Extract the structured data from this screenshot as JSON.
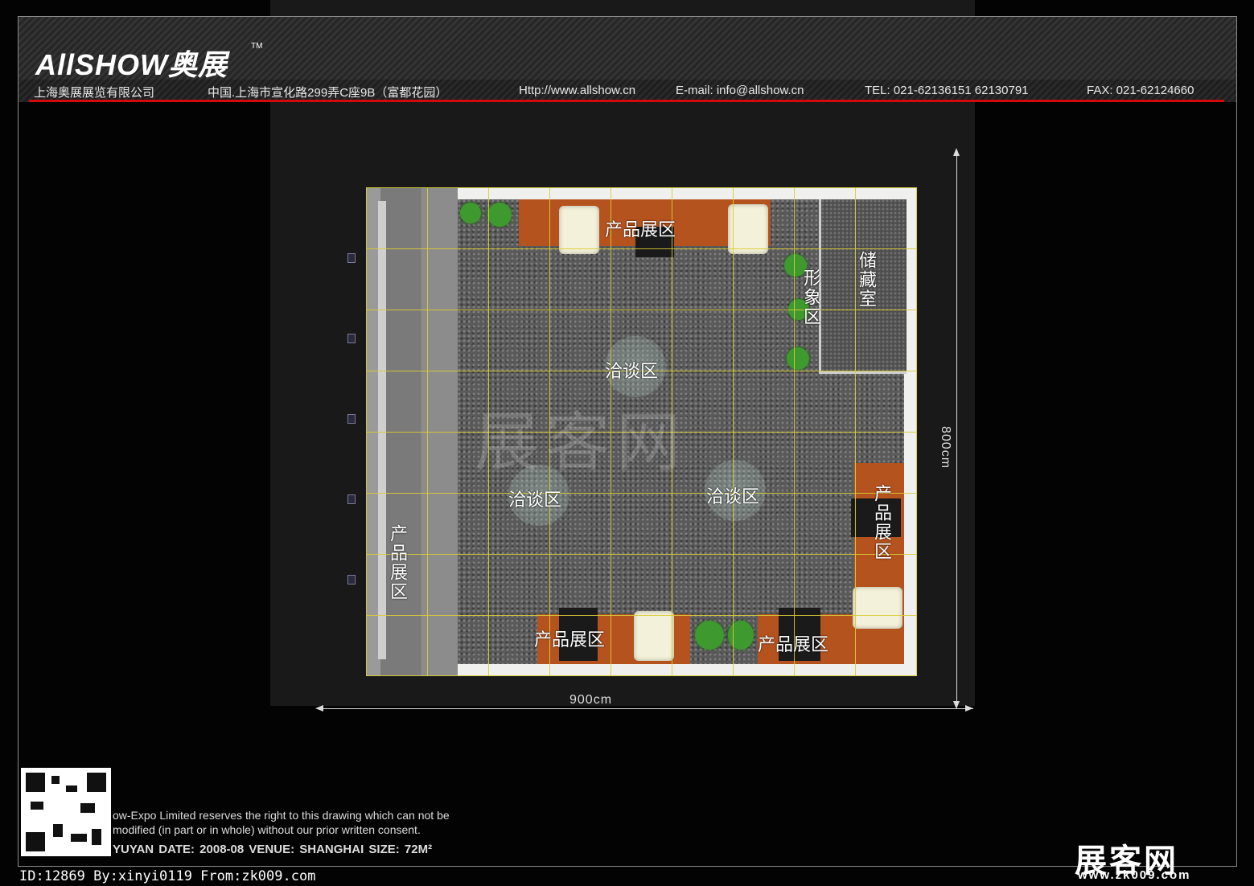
{
  "header": {
    "logo": "AllSHOW奥展",
    "logo_tm": "TM",
    "company": "上海奥展展览有限公司",
    "address": "中国.上海市宣化路299弄C座9B（富都花园）",
    "website": "Http://www.allshow.cn",
    "email": "E-mail: info@allshow.cn",
    "tel": "TEL:  021-62136151  62130791",
    "fax": "FAX:  021-62124660"
  },
  "plan": {
    "labels": {
      "product_top": "产品展区",
      "image_zone": "形象区",
      "storage": "储藏室",
      "negotiate_center": "洽谈区",
      "negotiate_left": "洽谈区",
      "negotiate_right": "洽谈区",
      "product_right": "产品展区",
      "product_left": "产品展区",
      "product_bottom_left": "产品展区",
      "product_bottom_right": "产品展区"
    },
    "watermark": "展客网"
  },
  "dimensions": {
    "width": "900cm",
    "height": "800cm"
  },
  "footer": {
    "copyright_1": "ow-Expo Limited reserves the right to this drawing which can not be",
    "copyright_2": "modified (in part or in whole) without our prior written consent.",
    "meta": "YUYAN     DATE: 2008-08     VENUE: SHANGHAI     SIZE: 72M²",
    "id_line": "ID:12869 By:xinyi0119 From:zk009.com",
    "brand": "展客网",
    "site": "www.zk009.com"
  },
  "colors": {
    "accent_red": "#d10a0a",
    "grid_yellow": "#d8cc33",
    "wood": "#b5531f"
  }
}
